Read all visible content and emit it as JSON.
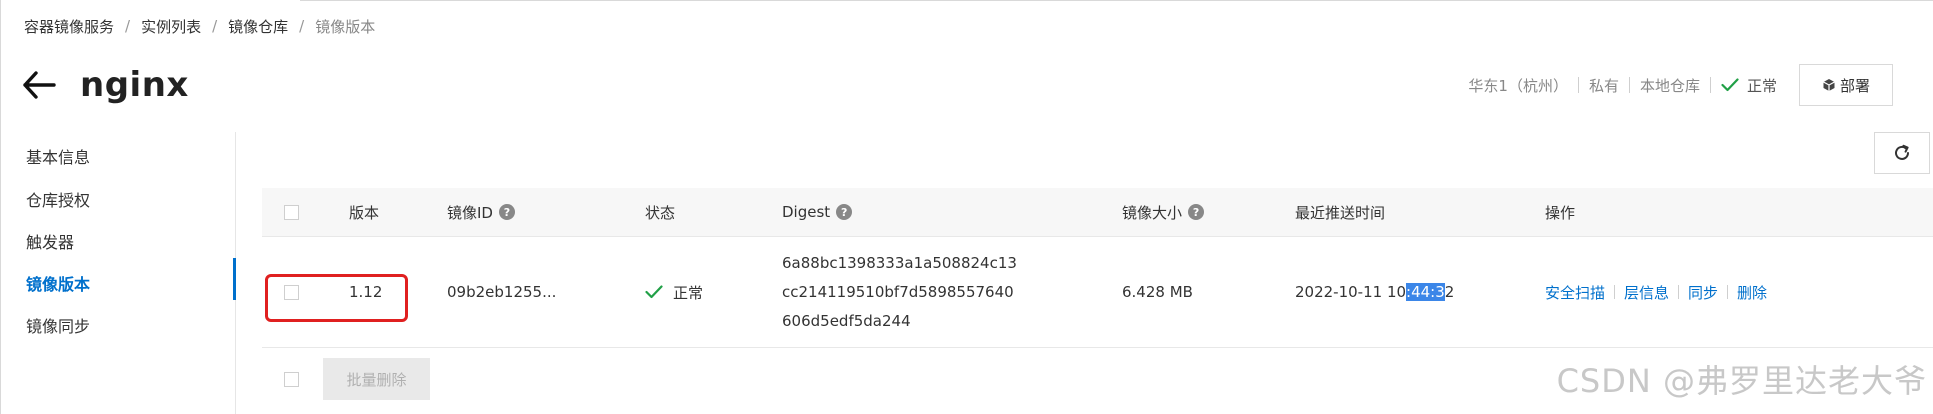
{
  "breadcrumb": [
    "容器镜像服务",
    "实例列表",
    "镜像仓库",
    "镜像版本"
  ],
  "page": {
    "title": "nginx"
  },
  "meta": {
    "region": "华东1（杭州）",
    "visibility": "私有",
    "repo_type": "本地仓库",
    "status": "正常",
    "deploy_label": "部署"
  },
  "sidebar": {
    "items": [
      {
        "label": "基本信息"
      },
      {
        "label": "仓库授权"
      },
      {
        "label": "触发器"
      },
      {
        "label": "镜像版本",
        "active": true
      },
      {
        "label": "镜像同步"
      }
    ]
  },
  "table": {
    "columns": {
      "version": "版本",
      "image_id": "镜像ID",
      "status": "状态",
      "digest": "Digest",
      "size": "镜像大小",
      "pushed": "最近推送时间",
      "actions": "操作"
    },
    "help_glyph": "?",
    "rows": [
      {
        "version": "1.12",
        "image_id": "09b2eb1255...",
        "status": "正常",
        "digest_lines": [
          "6a88bc1398333a1a508824c13",
          "cc214119510bf7d5898557640",
          "606d5edf5da244"
        ],
        "size": "6.428 MB",
        "pushed_before": "2022-10-11 10",
        "pushed_selected": ":44:3",
        "pushed_after": "2",
        "actions": [
          "安全扫描",
          "层信息",
          "同步",
          "删除"
        ]
      }
    ]
  },
  "footer": {
    "bulk_delete_label": "批量删除"
  },
  "watermark": "CSDN @弗罗里达老大爷",
  "colors": {
    "accent": "#0070cc",
    "success": "#21a047",
    "highlight_box": "#e02020",
    "selection": "#3b86e8"
  },
  "icons": [
    "back-arrow-icon",
    "check-icon",
    "deploy-icon",
    "refresh-icon",
    "help-icon"
  ]
}
